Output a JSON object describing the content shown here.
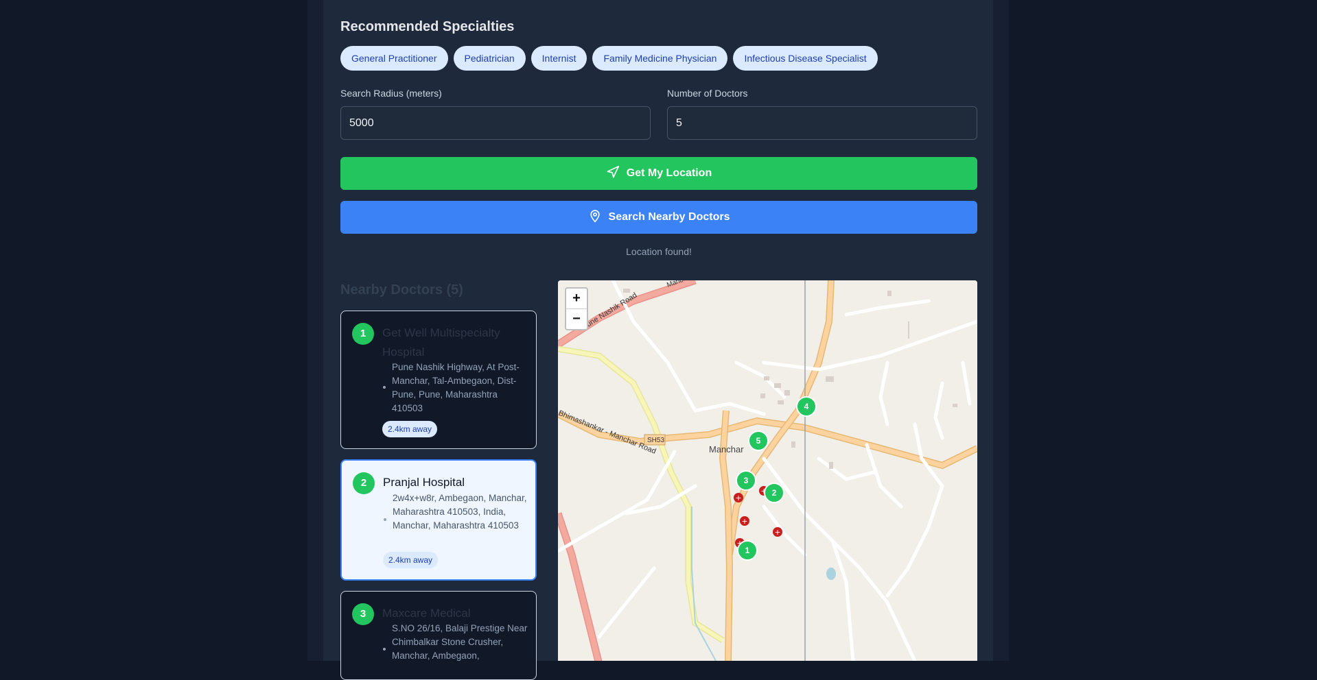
{
  "specialties": {
    "title": "Recommended Specialties",
    "items": [
      "General Practitioner",
      "Pediatrician",
      "Internist",
      "Family Medicine Physician",
      "Infectious Disease Specialist"
    ]
  },
  "form": {
    "radius_label": "Search Radius (meters)",
    "radius_value": "5000",
    "count_label": "Number of Doctors",
    "count_value": "5"
  },
  "buttons": {
    "location_label": "Get My Location",
    "search_label": "Search Nearby Doctors"
  },
  "status_text": "Location found!",
  "results": {
    "title": "Nearby Doctors (5)",
    "doctors": [
      {
        "number": "1",
        "name": "Get Well Multispecialty Hospital",
        "address": "Pune Nashik Highway, At Post- Manchar, Tal-Ambegaon, Dist- Pune, Pune, Maharashtra 410503",
        "distance": "2.4km away"
      },
      {
        "number": "2",
        "name": "Pranjal Hospital",
        "address": "2w4x+w8r, Ambegaon, Manchar, Maharashtra 410503, India, Manchar, Maharashtra 410503",
        "distance": "2.4km away"
      },
      {
        "number": "3",
        "name": "Maxcare Medical",
        "address": "S.NO 26/16, Balaji Prestige Near Chimbalkar Stone Crusher, Manchar, Ambegaon,",
        "distance": ""
      }
    ]
  },
  "map": {
    "zoom_in": "+",
    "zoom_out": "−",
    "labels": {
      "road_pune_nashik": "Pune Nashik Road",
      "road_shankar_manchar": "Bhimashankar - Manchar Road",
      "road_code": "SH53",
      "town": "Manchar",
      "road_top": "Manc"
    },
    "markers": [
      "1",
      "2",
      "3",
      "4",
      "5"
    ]
  },
  "colors": {
    "page_bg": "#111827",
    "panel_bg": "#1e293b",
    "green": "#22c55e",
    "blue": "#3b82f6",
    "chip_bg": "#dbeafe",
    "chip_text": "#1e40af",
    "hospital_red": "#c81e1e"
  },
  "icons": {
    "location_button": "navigation-arrow-icon",
    "search_button": "map-pin-icon",
    "hospital_marker": "hospital-cross-icon"
  }
}
